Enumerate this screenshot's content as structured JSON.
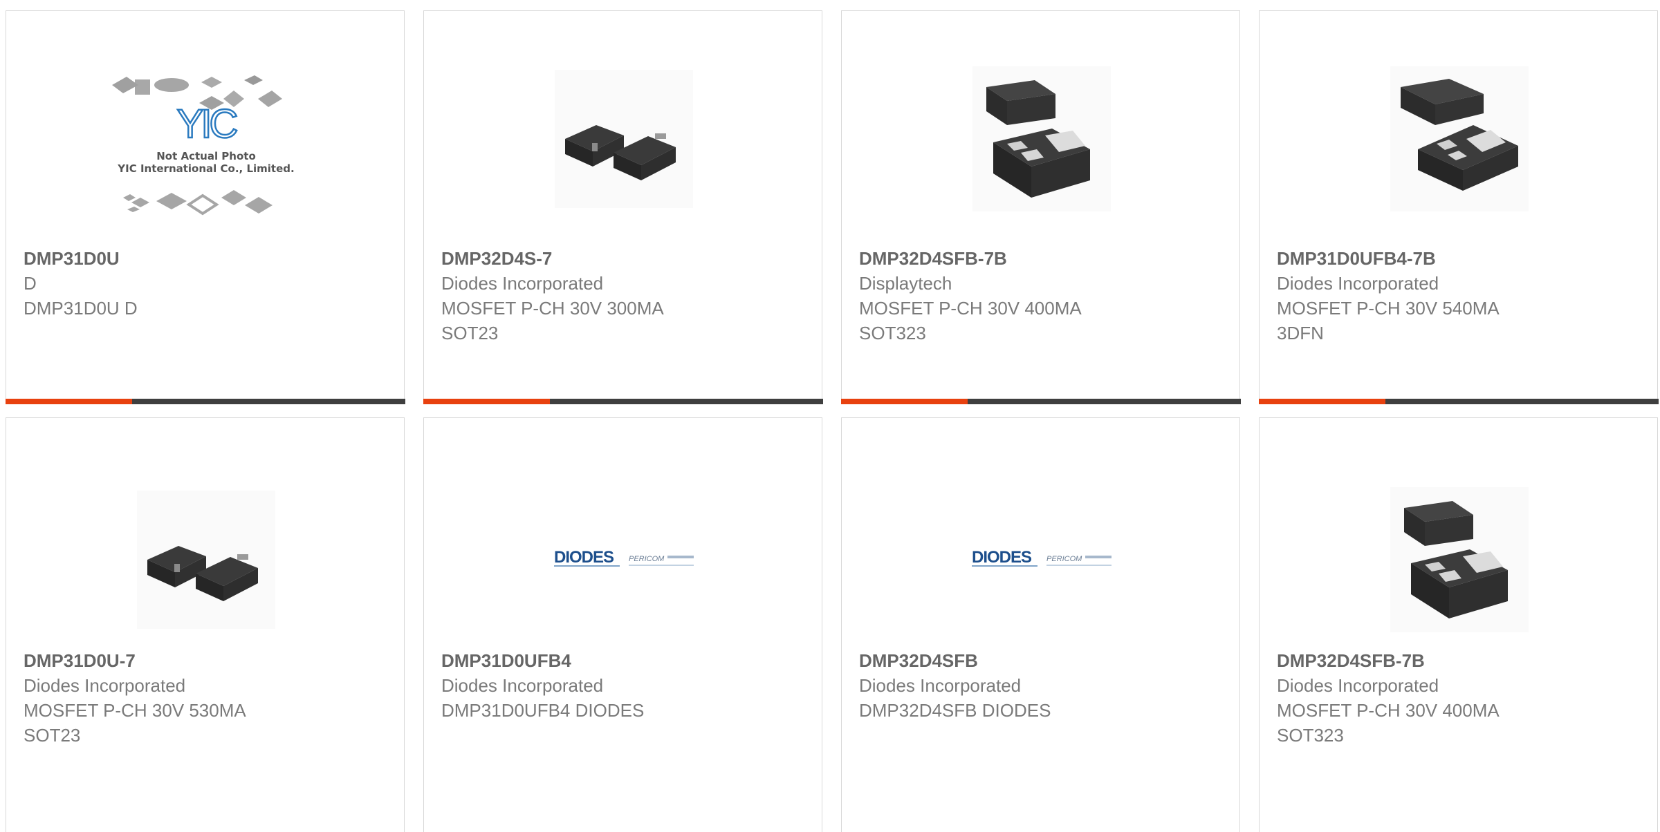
{
  "colors": {
    "accent": "#e8410f",
    "bar": "#3f3f3f",
    "border": "#d8d8d8",
    "text": "#7a7a7a"
  },
  "placeholder_image": {
    "line1": "Not Actual Photo",
    "line2": "YIC International Co., Limited."
  },
  "products": [
    {
      "part_number": "DMP31D0U",
      "manufacturer": "D",
      "description": "DMP31D0U D",
      "package": "",
      "image": "yic-placeholder-image"
    },
    {
      "part_number": "DMP32D4S-7",
      "manufacturer": "Diodes Incorporated",
      "description": "MOSFET P-CH 30V 300MA",
      "package": "SOT23",
      "image": "sot23-chip-image"
    },
    {
      "part_number": "DMP32D4SFB-7B",
      "manufacturer": "Displaytech",
      "description": "MOSFET P-CH 30V 400MA",
      "package": "SOT323",
      "image": "dfn-chip-pair-image"
    },
    {
      "part_number": "DMP31D0UFB4-7B",
      "manufacturer": "Diodes Incorporated",
      "description": "MOSFET P-CH 30V 540MA",
      "package": "3DFN",
      "image": "dfn-chip-pair-image"
    },
    {
      "part_number": "DMP31D0U-7",
      "manufacturer": "Diodes Incorporated",
      "description": "MOSFET P-CH 30V 530MA",
      "package": "SOT23",
      "image": "sot23-chip-image"
    },
    {
      "part_number": "DMP31D0UFB4",
      "manufacturer": "Diodes Incorporated",
      "description": "DMP31D0UFB4 DIODES",
      "package": "",
      "image": "diodes-pericom-logo"
    },
    {
      "part_number": "DMP32D4SFB",
      "manufacturer": "Diodes Incorporated",
      "description": "DMP32D4SFB DIODES",
      "package": "",
      "image": "diodes-pericom-logo"
    },
    {
      "part_number": "DMP32D4SFB-7B",
      "manufacturer": "Diodes Incorporated",
      "description": "MOSFET P-CH 30V 400MA",
      "package": "SOT323",
      "image": "dfn-chip-pair-image"
    }
  ],
  "logos": {
    "diodes": "DIODES",
    "pericom": "PERICOM"
  }
}
